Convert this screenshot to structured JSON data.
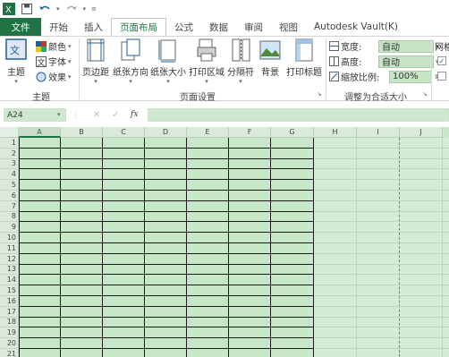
{
  "quick_access": {
    "excel_icon": "excel-logo-icon",
    "save_icon": "save-icon",
    "undo_icon": "undo-icon",
    "redo_icon": "redo-icon",
    "more_icon": "customize-icon"
  },
  "tabs": [
    {
      "label": "文件"
    },
    {
      "label": "开始"
    },
    {
      "label": "插入"
    },
    {
      "label": "页面布局"
    },
    {
      "label": "公式"
    },
    {
      "label": "数据"
    },
    {
      "label": "审阅"
    },
    {
      "label": "视图"
    },
    {
      "label": "Autodesk Vault(K)"
    }
  ],
  "ribbon": {
    "themes": {
      "theme_label": "主题",
      "colors_label": "颜色",
      "fonts_label": "字体",
      "effects_label": "效果",
      "group_label": "主题"
    },
    "page_setup": {
      "margins_label": "页边距",
      "orientation_label": "纸张方向",
      "size_label": "纸张大小",
      "print_area_label": "打印区域",
      "breaks_label": "分隔符",
      "background_label": "背景",
      "print_titles_label": "打印标题",
      "group_label": "页面设置"
    },
    "scale_to_fit": {
      "width_label": "宽度:",
      "width_value": "自动",
      "height_label": "高度:",
      "height_value": "自动",
      "scale_label": "缩放比例:",
      "scale_value": "100%",
      "group_label": "调整为合适大小"
    },
    "sheet_options": {
      "gridlines_label": "网格"
    }
  },
  "formula_bar": {
    "name_box": "A24",
    "fx_label": "fx",
    "formula_value": ""
  },
  "sheet": {
    "columns": [
      "A",
      "B",
      "C",
      "D",
      "E",
      "F",
      "G",
      "H",
      "I",
      "J"
    ],
    "rows": [
      "1",
      "2",
      "3",
      "4",
      "5",
      "6",
      "7",
      "8",
      "9",
      "10",
      "11",
      "12",
      "13",
      "14",
      "15",
      "16",
      "17",
      "18",
      "19",
      "20",
      "21"
    ],
    "selected_column": "A"
  },
  "colors": {
    "accent": "#217346",
    "sheet_bg": "#c9e7c9",
    "border_black": "#1a1a1a"
  }
}
